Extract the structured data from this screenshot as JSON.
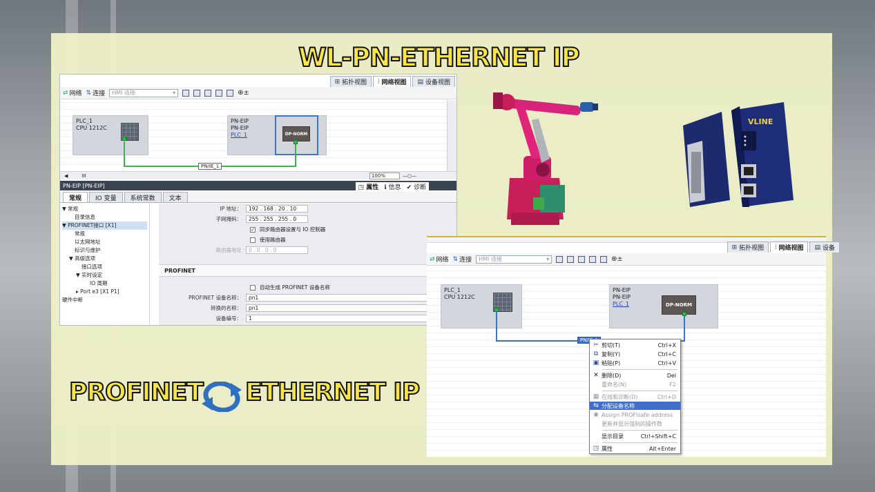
{
  "titles": {
    "top": "WL-PN-ETHERNET IP",
    "bottom_left": "PROFINET",
    "bottom_right": "ETHERNET IP"
  },
  "icons": [
    "cycle-arrows-icon",
    "robot-arm-image",
    "gateway-device-image",
    "network-view-icon",
    "topology-view-icon",
    "device-view-icon",
    "zoom-icon"
  ],
  "colors": {
    "accent_yellow": "#f7e34a",
    "link_green": "#3bb24f",
    "link_blue": "#3a73c8",
    "menu_highlight": "#3f6fc6",
    "panel_bg": "#ecf0c6"
  },
  "device_label": "VLINE",
  "left_window": {
    "tabs": [
      "拓扑视图",
      "网络视图",
      "设备视图"
    ],
    "toolbar": {
      "network": "网络",
      "connect": "连接",
      "hmi_combo": "HMI 连接"
    },
    "plc": {
      "name": "PLC_1",
      "cpu": "CPU 1212C"
    },
    "pneip": {
      "name": "PN-EIP",
      "type": "PN-EIP",
      "link": "PLC_1",
      "block": "DP-NORM"
    },
    "network_label": "PN/IE_1",
    "zoom": "100%",
    "scroll_mark": "III",
    "inspector": {
      "title": "PN-EIP [PN-EIP]",
      "right_tabs": [
        "属性",
        "信息",
        "诊断"
      ],
      "tabs": [
        "常规",
        "IO 变量",
        "系统常数",
        "文本"
      ],
      "tree": [
        "▼ 常规",
        "目录信息",
        "▼ PROFINET接口 [X1]",
        "常规",
        "以太网地址",
        "标识与维护",
        "▼ 高级选项",
        "接口选项",
        "▼ 实时设定",
        "IO 周期",
        "▸ Port e3 [X1 P1]",
        "硬件中断"
      ],
      "ip_label": "IP 地址：",
      "ip": "192 . 168 . 20 . 10",
      "mask_label": "子网掩码：",
      "mask": "255 . 255 . 255 . 0",
      "sync_router": "同步路由器设置与 IO 控制器",
      "use_router": "使用路由器",
      "router_label": "路由器地址",
      "router": "0 . 0 . 0 . 0",
      "section": "PROFINET",
      "auto_name": "自动生成 PROFINET 设备名称",
      "dev_name_label": "PROFINET 设备名称：",
      "dev_name": "pn1",
      "conv_name_label": "转换的名称：",
      "conv_name": "pn1",
      "dev_num_label": "设备编号：",
      "dev_num": "1"
    }
  },
  "right_window": {
    "tabs": [
      "拓扑视图",
      "网络视图",
      "设备"
    ],
    "toolbar": {
      "network": "网络",
      "connect": "连接",
      "hmi_combo": "HMI 连接"
    },
    "plc": {
      "name": "PLC_1",
      "cpu": "CPU 1212C"
    },
    "pneip": {
      "name": "PN-EIP",
      "type": "PN-EIP",
      "link": "PLC_1",
      "block": "DP-NORM"
    },
    "network_label": "PN/IE_1",
    "context_menu": [
      {
        "label": "剪切(T)",
        "key": "Ctrl+X"
      },
      {
        "label": "复制(Y)",
        "key": "Ctrl+C"
      },
      {
        "label": "粘贴(P)",
        "key": "Ctrl+V"
      },
      {
        "label": "删除(D)",
        "key": "Del"
      },
      {
        "label": "重命名(N)",
        "key": "F2"
      },
      {
        "label": "在线和诊断(D)",
        "key": "Ctrl+D"
      },
      {
        "label": "分配设备名称",
        "key": ""
      },
      {
        "label": "Assign PROFIsafe address",
        "key": ""
      },
      {
        "label": "更新并显示强制的操作数",
        "key": ""
      },
      {
        "label": "显示目录",
        "key": "Ctrl+Shift+C"
      },
      {
        "label": "属性",
        "key": "Alt+Enter"
      }
    ]
  }
}
